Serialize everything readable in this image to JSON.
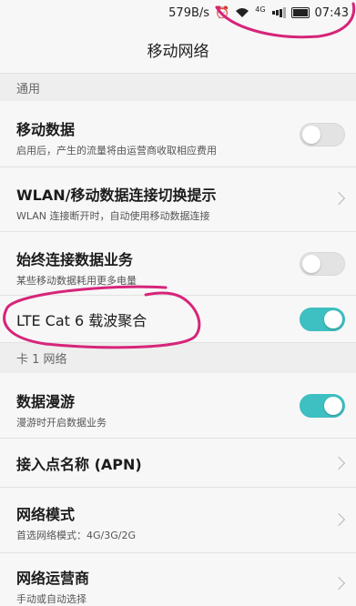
{
  "status": {
    "speed": "579B/s",
    "network": "4G",
    "time": "07:43"
  },
  "header": {
    "title": "移动网络"
  },
  "section_general": "通用",
  "mobile_data": {
    "title": "移动数据",
    "sub": "启用后，产生的流量将由运营商收取相应费用",
    "enabled": false
  },
  "wlan_switch": {
    "title": "WLAN/移动数据连接切换提示",
    "sub": "WLAN 连接断开时，自动使用移动数据连接"
  },
  "always_on": {
    "title": "始终连接数据业务",
    "sub": "某些移动数据耗用更多电量",
    "enabled": false
  },
  "lte_ca": {
    "title": "LTE Cat 6 载波聚合",
    "enabled": true
  },
  "section_card1": "卡 1 网络",
  "roaming": {
    "title": "数据漫游",
    "sub": "漫游时开启数据业务",
    "enabled": true
  },
  "apn": {
    "title": "接入点名称 (APN)"
  },
  "network_mode": {
    "title": "网络模式",
    "sub": "首选网络模式：4G/3G/2G"
  },
  "operator": {
    "title": "网络运营商",
    "sub": "手动或自动选择"
  },
  "colors": {
    "accent": "#3ebfc1",
    "annotation": "#d6257a"
  }
}
